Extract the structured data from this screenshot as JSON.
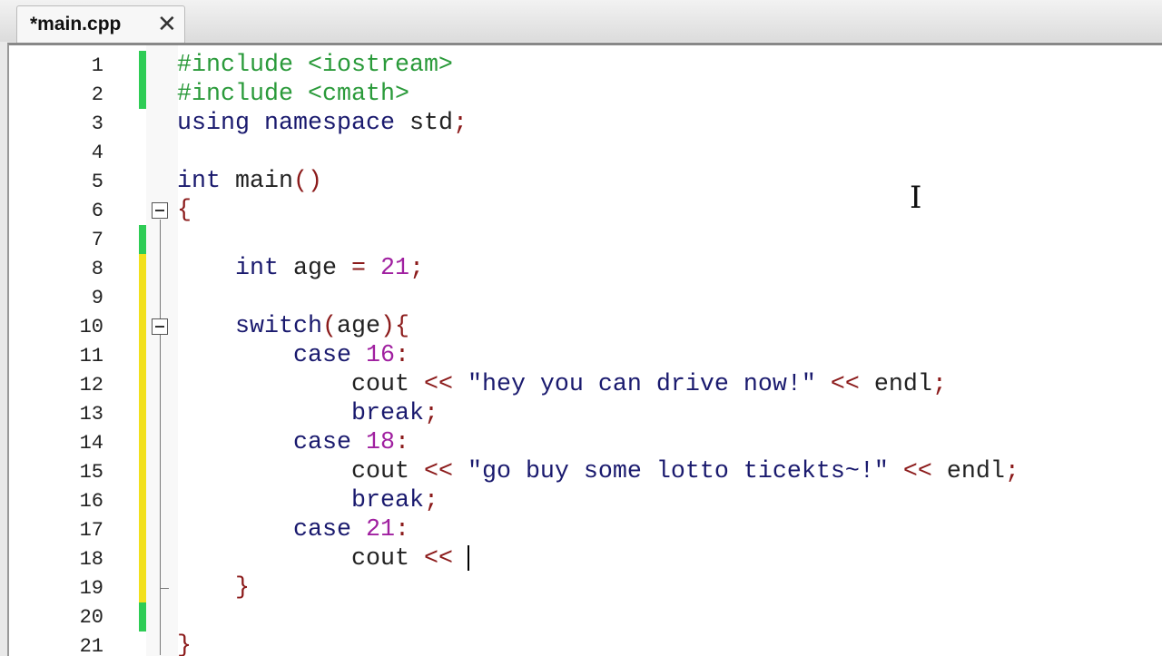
{
  "tab": {
    "label": "*main.cpp",
    "close": "✕"
  },
  "colors": {
    "saved": "#2ecc55",
    "modified": "#f2e01c"
  },
  "lines": [
    {
      "n": "1",
      "mark": "saved",
      "tokens": [
        [
          "pp",
          "#include <iostream>"
        ]
      ]
    },
    {
      "n": "2",
      "mark": "saved",
      "tokens": [
        [
          "pp",
          "#include <cmath>"
        ]
      ]
    },
    {
      "n": "3",
      "mark": "",
      "tokens": [
        [
          "kw",
          "using namespace "
        ],
        [
          "id",
          "std"
        ],
        [
          "op",
          ";"
        ]
      ]
    },
    {
      "n": "4",
      "mark": "",
      "tokens": []
    },
    {
      "n": "5",
      "mark": "",
      "tokens": [
        [
          "kw",
          "int "
        ],
        [
          "id",
          "main"
        ],
        [
          "op",
          "()"
        ]
      ]
    },
    {
      "n": "6",
      "mark": "",
      "fold": true,
      "tokens": [
        [
          "op",
          "{"
        ]
      ]
    },
    {
      "n": "7",
      "mark": "saved",
      "tokens": []
    },
    {
      "n": "8",
      "mark": "modified",
      "tokens": [
        [
          "id",
          "    "
        ],
        [
          "kw",
          "int "
        ],
        [
          "id",
          "age "
        ],
        [
          "op",
          "= "
        ],
        [
          "num",
          "21"
        ],
        [
          "op",
          ";"
        ]
      ]
    },
    {
      "n": "9",
      "mark": "modified",
      "tokens": []
    },
    {
      "n": "10",
      "mark": "modified",
      "fold": true,
      "tokens": [
        [
          "id",
          "    "
        ],
        [
          "kw",
          "switch"
        ],
        [
          "op",
          "("
        ],
        [
          "id",
          "age"
        ],
        [
          "op",
          "){"
        ]
      ]
    },
    {
      "n": "11",
      "mark": "modified",
      "tokens": [
        [
          "id",
          "        "
        ],
        [
          "kw",
          "case "
        ],
        [
          "num",
          "16"
        ],
        [
          "op",
          ":"
        ]
      ]
    },
    {
      "n": "12",
      "mark": "modified",
      "tokens": [
        [
          "id",
          "            cout "
        ],
        [
          "op",
          "<< "
        ],
        [
          "str",
          "\"hey you can drive now!\" "
        ],
        [
          "op",
          "<< "
        ],
        [
          "id",
          "endl"
        ],
        [
          "op",
          ";"
        ]
      ]
    },
    {
      "n": "13",
      "mark": "modified",
      "tokens": [
        [
          "id",
          "            "
        ],
        [
          "kw",
          "break"
        ],
        [
          "op",
          ";"
        ]
      ]
    },
    {
      "n": "14",
      "mark": "modified",
      "tokens": [
        [
          "id",
          "        "
        ],
        [
          "kw",
          "case "
        ],
        [
          "num",
          "18"
        ],
        [
          "op",
          ":"
        ]
      ]
    },
    {
      "n": "15",
      "mark": "modified",
      "tokens": [
        [
          "id",
          "            cout "
        ],
        [
          "op",
          "<< "
        ],
        [
          "str",
          "\"go buy some lotto ticekts~!\" "
        ],
        [
          "op",
          "<< "
        ],
        [
          "id",
          "endl"
        ],
        [
          "op",
          ";"
        ]
      ]
    },
    {
      "n": "16",
      "mark": "modified",
      "tokens": [
        [
          "id",
          "            "
        ],
        [
          "kw",
          "break"
        ],
        [
          "op",
          ";"
        ]
      ]
    },
    {
      "n": "17",
      "mark": "modified",
      "tokens": [
        [
          "id",
          "        "
        ],
        [
          "kw",
          "case "
        ],
        [
          "num",
          "21"
        ],
        [
          "op",
          ":"
        ]
      ]
    },
    {
      "n": "18",
      "mark": "modified",
      "caret": true,
      "tokens": [
        [
          "id",
          "            cout "
        ],
        [
          "op",
          "<< "
        ]
      ]
    },
    {
      "n": "19",
      "mark": "modified",
      "tokens": [
        [
          "id",
          "    "
        ],
        [
          "op",
          "}"
        ]
      ]
    },
    {
      "n": "20",
      "mark": "saved",
      "tokens": []
    },
    {
      "n": "21",
      "mark": "",
      "tokens": [
        [
          "op",
          "}"
        ]
      ]
    }
  ]
}
